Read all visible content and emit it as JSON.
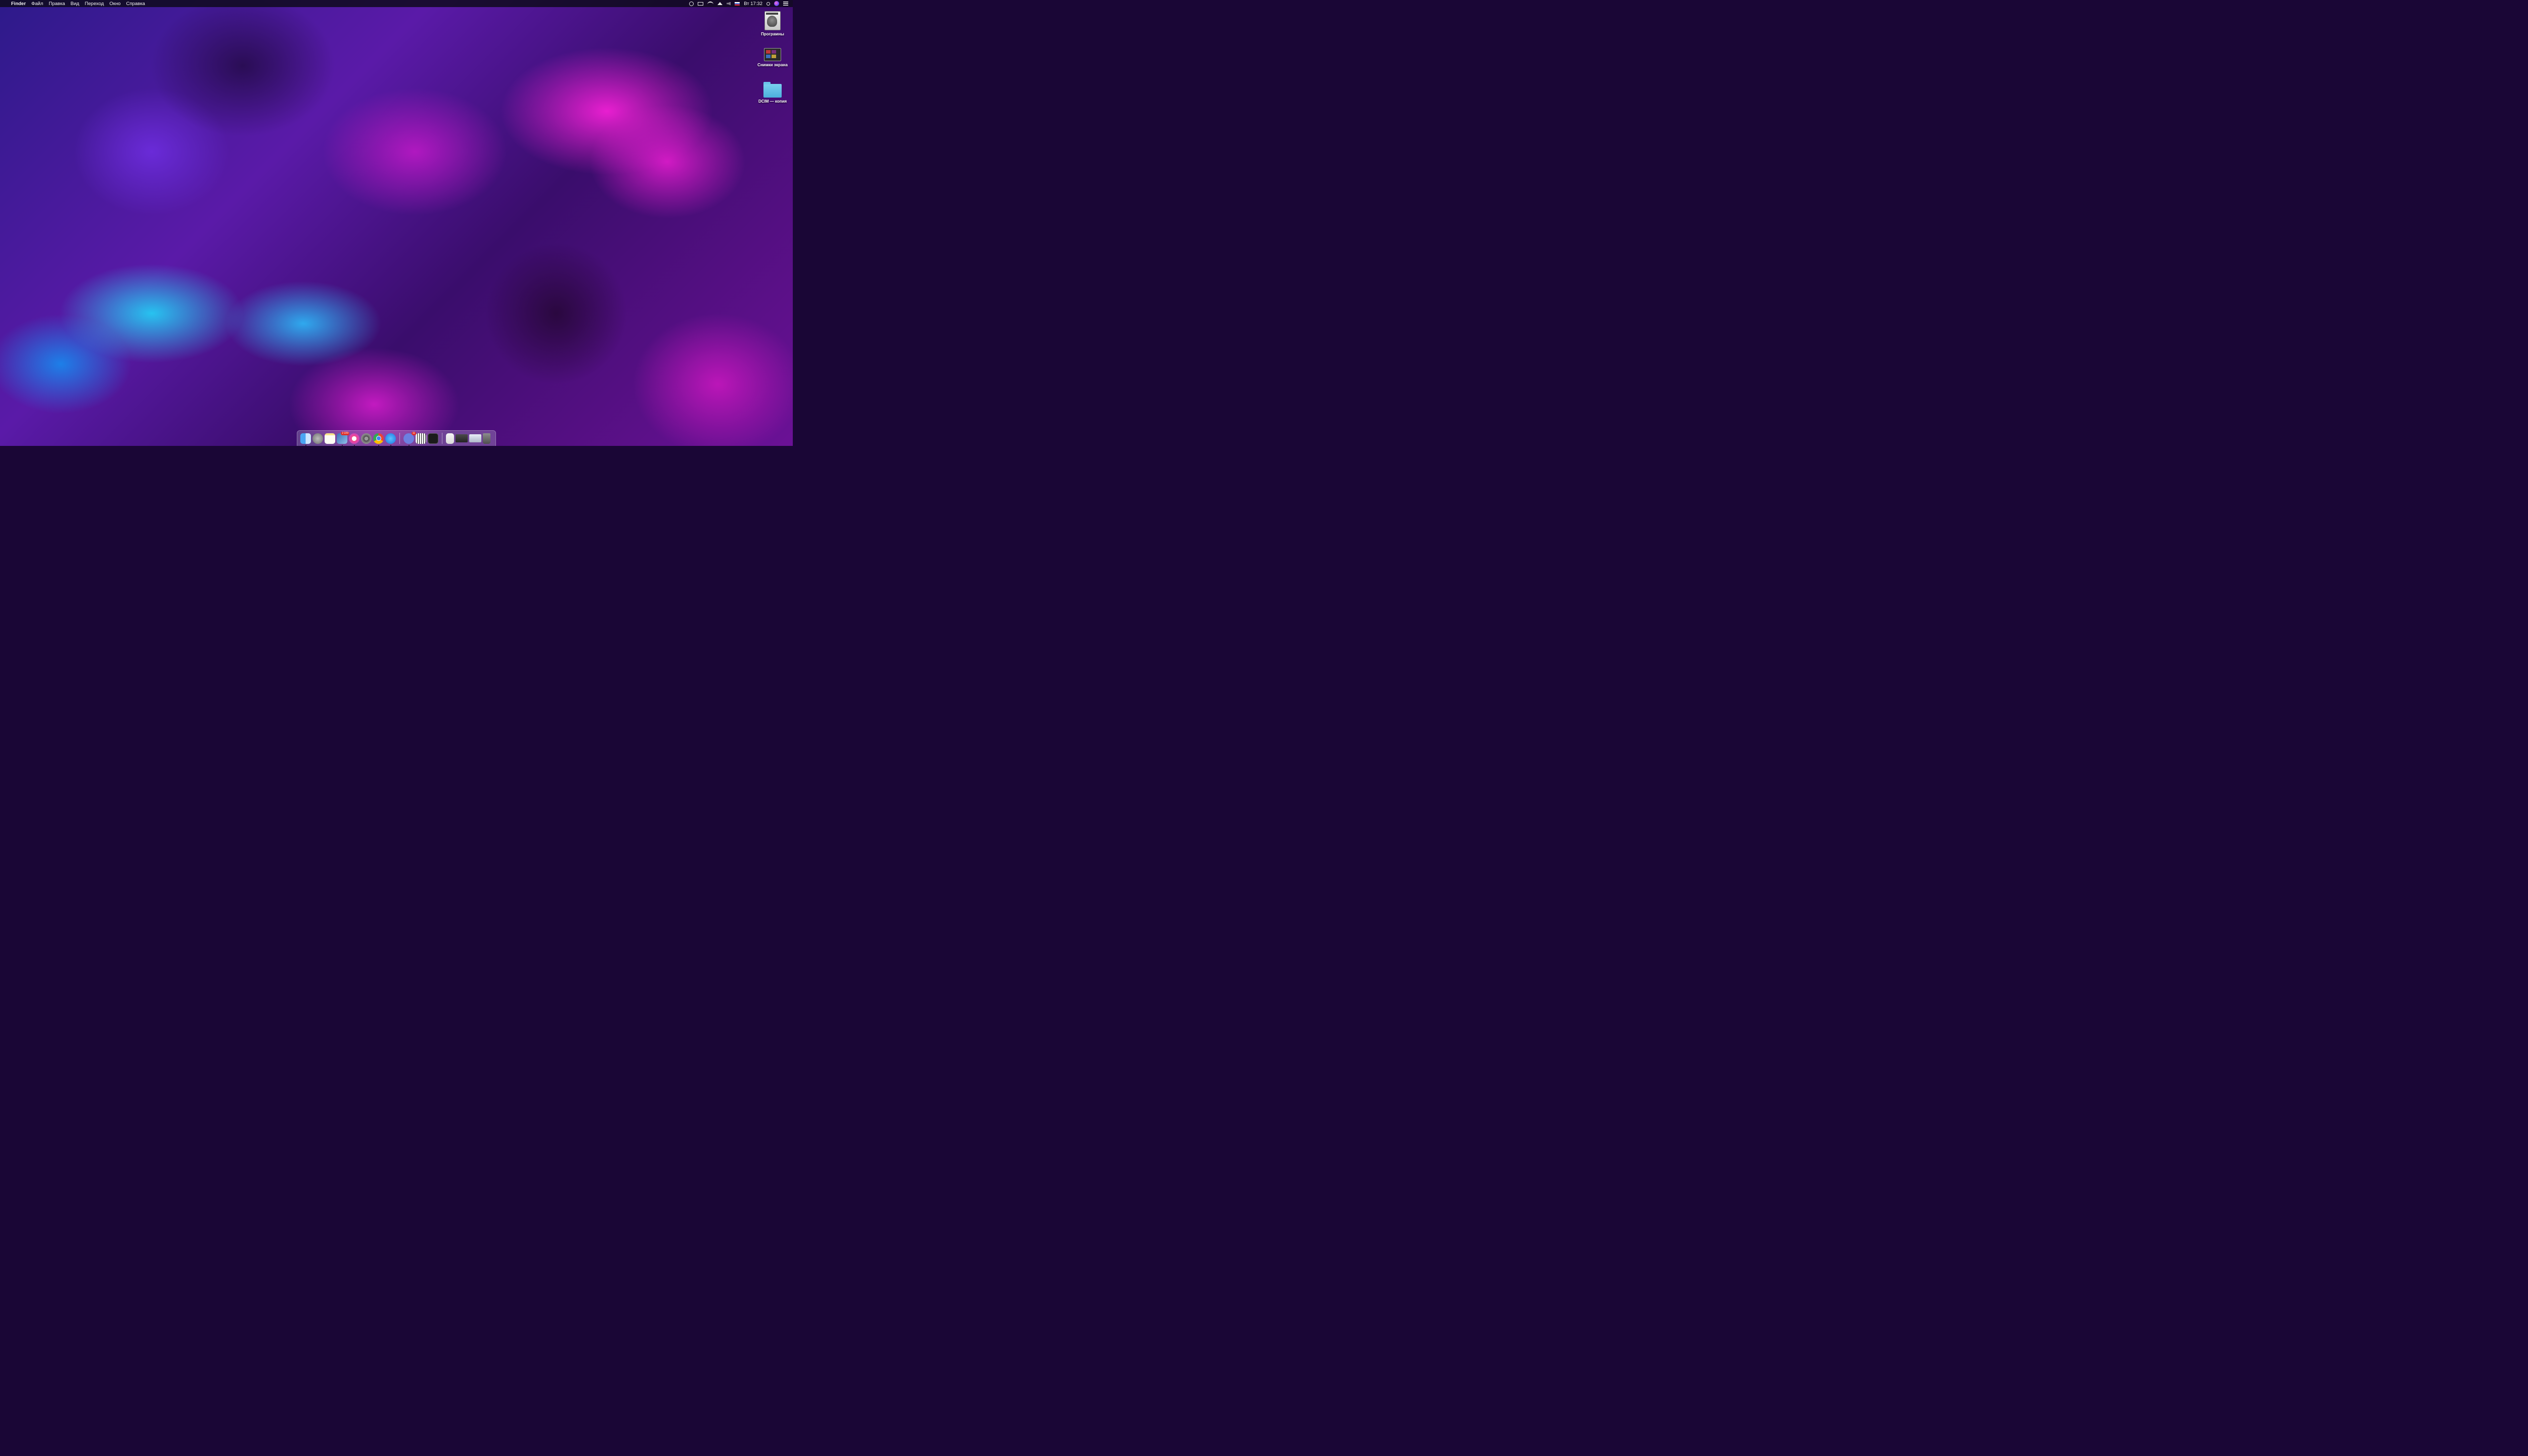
{
  "menubar": {
    "app_name": "Finder",
    "menus": [
      "Файл",
      "Правка",
      "Вид",
      "Переход",
      "Окно",
      "Справка"
    ],
    "status_icons": [
      "user-icon",
      "display-icon",
      "wifi-icon",
      "eject-icon",
      "volume-icon",
      "flag-ru-icon"
    ],
    "clock": "Вт 17:32",
    "right_icons": [
      "search-icon",
      "siri-icon",
      "notification-center-icon"
    ]
  },
  "desktop_icons": [
    {
      "label": "Програмны",
      "icon": "image-file-icon"
    },
    {
      "label": "Снимки экрана",
      "icon": "screenshot-folder-icon"
    },
    {
      "label": "DCIM — копия",
      "icon": "folder-icon"
    }
  ],
  "dock": {
    "apps": [
      {
        "name": "finder",
        "running": true
      },
      {
        "name": "launchpad",
        "running": false
      },
      {
        "name": "notes",
        "running": false
      },
      {
        "name": "preview",
        "running": true,
        "badge": "2 229"
      },
      {
        "name": "itunes",
        "running": true
      },
      {
        "name": "system-preferences",
        "running": false
      },
      {
        "name": "chrome",
        "running": true
      },
      {
        "name": "app-store",
        "running": true
      },
      {
        "name": "discord",
        "running": true,
        "badge": "11"
      },
      {
        "name": "piano",
        "running": false
      },
      {
        "name": "activity-monitor",
        "running": false
      }
    ],
    "files": [
      "document",
      "screenshot-stack",
      "mail-attachments",
      "trash"
    ]
  },
  "colors": {
    "wallpaper_magenta": "#e81fd0",
    "wallpaper_cyan": "#27c3f0",
    "wallpaper_purple": "#5a1aa8",
    "menubar_bg": "#0c0a18"
  }
}
